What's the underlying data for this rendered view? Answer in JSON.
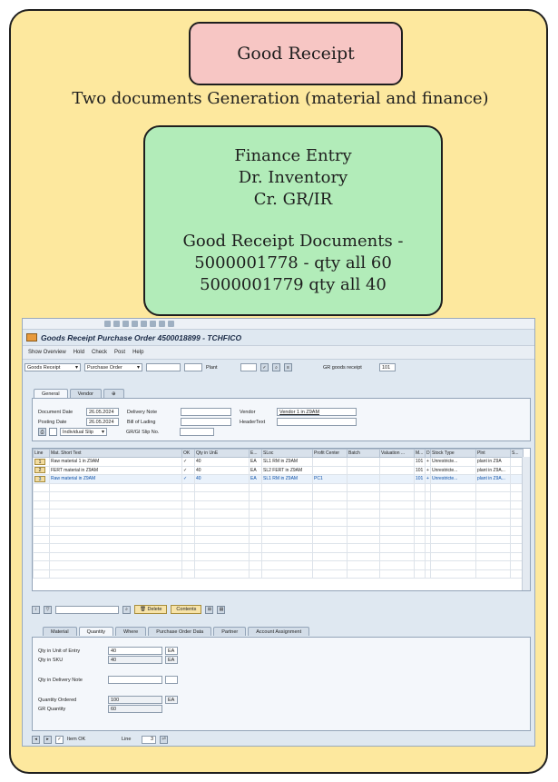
{
  "diagram": {
    "goods_receipt_title": "Good Receipt",
    "subtitle": "Two documents Generation (material and finance)",
    "finance": {
      "line1": "Finance Entry",
      "line2": "Dr. Inventory",
      "line3": "Cr. GR/IR",
      "line4": "Good Receipt Documents -",
      "line5": "5000001778 - qty all 60",
      "line6": "5000001779 qty all 40"
    }
  },
  "sap": {
    "title": "Goods Receipt Purchase Order 4500018899 - TCHFICO",
    "menu": [
      "Show Overview",
      "Hold",
      "Check",
      "Post",
      "Help"
    ],
    "filter": {
      "transaction": "Goods Receipt",
      "reference": "Purchase Order",
      "plant_label": "Plant",
      "movement_label": "GR goods receipt",
      "movement_type": "101"
    },
    "header_tabs": [
      "General",
      "Vendor"
    ],
    "header": {
      "document_date_label": "Document Date",
      "document_date": "26.05.2024",
      "posting_date_label": "Posting Date",
      "posting_date": "26.05.2024",
      "slip_option": "Individual Slip",
      "delivery_note_label": "Delivery Note",
      "bill_of_lading_label": "Bill of Lading",
      "gr_gi_slip_label": "GR/GI Slip No.",
      "vendor_label": "Vendor",
      "vendor_value": "Vendor 1 in Z9AM",
      "header_text_label": "HeaderText"
    },
    "grid": {
      "columns": [
        "Line",
        "Mat. Short Text",
        "OK",
        "Qty in UnE",
        "E...",
        "SLoc",
        "Profit Center",
        "Batch",
        "Valuation ...",
        "M...",
        "D",
        "Stock Type",
        "Plnt",
        "S..."
      ],
      "rows": [
        {
          "line": "1",
          "text": "Raw material 1 in Z9AM",
          "ok": "✓",
          "qty": "40",
          "unit": "EA",
          "sloc": "SL1 RM in Z9AM",
          "pc": "",
          "mvt": "101",
          "d": "+",
          "stock": "Unrestricte...",
          "plant": "plant in Z9A"
        },
        {
          "line": "2",
          "text": "FERT material in Z9AM",
          "ok": "✓",
          "qty": "40",
          "unit": "EA",
          "sloc": "SL2 FERT in Z9AM",
          "pc": "",
          "mvt": "101",
          "d": "+",
          "stock": "Unrestricte...",
          "plant": "plant in Z9A..."
        },
        {
          "line": "3",
          "text": "Raw material in Z9AM",
          "ok": "✓",
          "qty": "40",
          "unit": "EA",
          "sloc": "SL1 RM in Z9AM",
          "pc": "PC1",
          "mvt": "101",
          "d": "+",
          "stock": "Unrestricte...",
          "plant": "plant in Z9A..."
        }
      ]
    },
    "actions": {
      "delete": "Delete",
      "contents": "Contents"
    },
    "detail_tabs": [
      "Material",
      "Quantity",
      "Where",
      "Purchase Order Data",
      "Partner",
      "Account Assignment"
    ],
    "detail": {
      "qty_entry_label": "Qty in Unit of Entry",
      "qty_entry": "40",
      "qty_entry_unit": "EA",
      "qty_sku_label": "Qty in SKU",
      "qty_sku": "40",
      "qty_sku_unit": "EA",
      "qty_delivery_label": "Qty in Delivery Note",
      "qty_ordered_label": "Quantity Ordered",
      "qty_ordered": "100",
      "qty_ordered_unit": "EA",
      "gr_qty_label": "GR Quantity",
      "gr_qty": "60"
    },
    "footer": {
      "item_ok": "Item OK",
      "line_label": "Line",
      "line_value": "3"
    }
  }
}
